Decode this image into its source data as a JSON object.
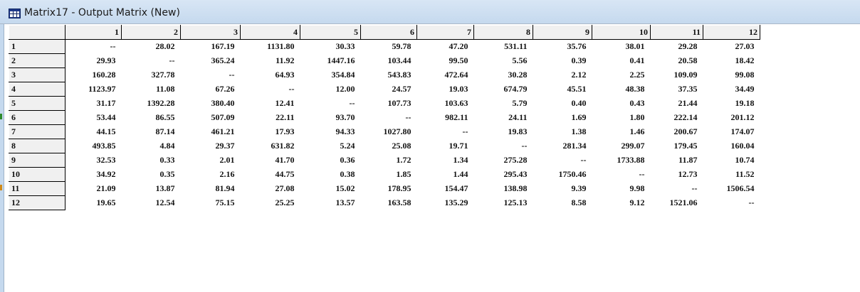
{
  "window": {
    "title": "Matrix17 - Output Matrix (New)",
    "icon": "matrix-table-icon"
  },
  "matrix": {
    "columns": [
      "1",
      "2",
      "3",
      "4",
      "5",
      "6",
      "7",
      "8",
      "9",
      "10",
      "11",
      "12"
    ],
    "rows": [
      {
        "label": "1",
        "values": [
          "--",
          "28.02",
          "167.19",
          "1131.80",
          "30.33",
          "59.78",
          "47.20",
          "531.11",
          "35.76",
          "38.01",
          "29.28",
          "27.03"
        ]
      },
      {
        "label": "2",
        "values": [
          "29.93",
          "--",
          "365.24",
          "11.92",
          "1447.16",
          "103.44",
          "99.50",
          "5.56",
          "0.39",
          "0.41",
          "20.58",
          "18.42"
        ]
      },
      {
        "label": "3",
        "values": [
          "160.28",
          "327.78",
          "--",
          "64.93",
          "354.84",
          "543.83",
          "472.64",
          "30.28",
          "2.12",
          "2.25",
          "109.09",
          "99.08"
        ]
      },
      {
        "label": "4",
        "values": [
          "1123.97",
          "11.08",
          "67.26",
          "--",
          "12.00",
          "24.57",
          "19.03",
          "674.79",
          "45.51",
          "48.38",
          "37.35",
          "34.49"
        ]
      },
      {
        "label": "5",
        "values": [
          "31.17",
          "1392.28",
          "380.40",
          "12.41",
          "--",
          "107.73",
          "103.63",
          "5.79",
          "0.40",
          "0.43",
          "21.44",
          "19.18"
        ]
      },
      {
        "label": "6",
        "values": [
          "53.44",
          "86.55",
          "507.09",
          "22.11",
          "93.70",
          "--",
          "982.11",
          "24.11",
          "1.69",
          "1.80",
          "222.14",
          "201.12"
        ]
      },
      {
        "label": "7",
        "values": [
          "44.15",
          "87.14",
          "461.21",
          "17.93",
          "94.33",
          "1027.80",
          "--",
          "19.83",
          "1.38",
          "1.46",
          "200.67",
          "174.07"
        ]
      },
      {
        "label": "8",
        "values": [
          "493.85",
          "4.84",
          "29.37",
          "631.82",
          "5.24",
          "25.08",
          "19.71",
          "--",
          "281.34",
          "299.07",
          "179.45",
          "160.04"
        ]
      },
      {
        "label": "9",
        "values": [
          "32.53",
          "0.33",
          "2.01",
          "41.70",
          "0.36",
          "1.72",
          "1.34",
          "275.28",
          "--",
          "1733.88",
          "11.87",
          "10.74"
        ]
      },
      {
        "label": "10",
        "values": [
          "34.92",
          "0.35",
          "2.16",
          "44.75",
          "0.38",
          "1.85",
          "1.44",
          "295.43",
          "1750.46",
          "--",
          "12.73",
          "11.52"
        ]
      },
      {
        "label": "11",
        "values": [
          "21.09",
          "13.87",
          "81.94",
          "27.08",
          "15.02",
          "178.95",
          "154.47",
          "138.98",
          "9.39",
          "9.98",
          "--",
          "1506.54"
        ]
      },
      {
        "label": "12",
        "values": [
          "19.65",
          "12.54",
          "75.15",
          "25.25",
          "13.57",
          "163.58",
          "135.29",
          "125.13",
          "8.58",
          "9.12",
          "1521.06",
          "--"
        ]
      }
    ]
  },
  "colors": {
    "titlebar": "#c5d9ee",
    "header_bg": "#f0f0f0",
    "left_marker_green": "#2e8b2e",
    "left_marker_orange": "#d08a1a"
  }
}
